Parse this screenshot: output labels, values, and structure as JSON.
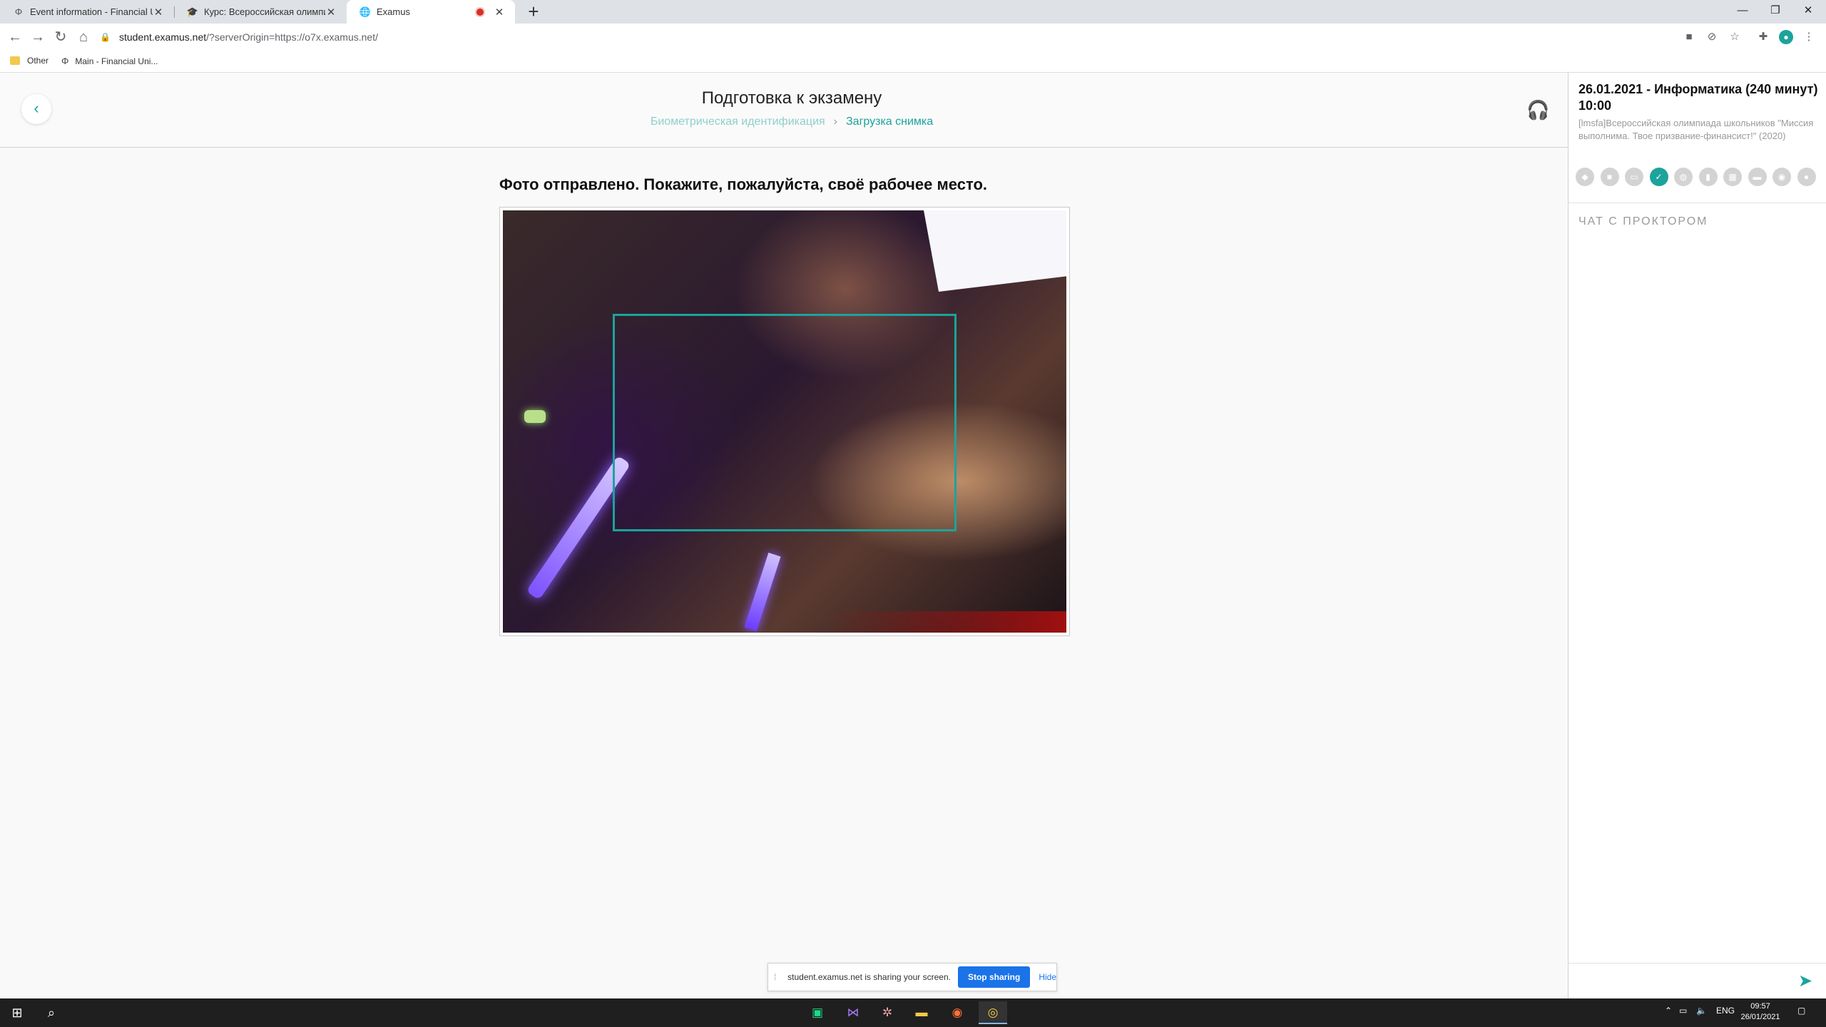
{
  "browser": {
    "tabs": [
      {
        "label": "Event information - Financial Uni",
        "favicon": "Φ"
      },
      {
        "label": "Курс: Всероссийская олимпиада",
        "favicon": "🎓"
      },
      {
        "label": "Examus",
        "favicon": "🌐"
      }
    ],
    "url_domain": "student.examus.net",
    "url_path": "/?serverOrigin=https://o7x.examus.net/",
    "bookmarks": [
      "Other",
      "Main - Financial Uni..."
    ]
  },
  "header": {
    "title": "Подготовка к экзамену",
    "breadcrumb_step1": "Биометрическая идентификация",
    "breadcrumb_step2": "Загрузка снимка"
  },
  "main": {
    "instruction": "Фото отправлено. Покажите, пожалуйста, своё рабочее место."
  },
  "sidebar": {
    "exam_title": "26.01.2021 - Информатика (240 минут) 10:00",
    "exam_description": "[lmsfa]Всероссийская олимпиада школьников \"Миссия выполнима. Твое призвание-финансист!\" (2020)",
    "chat_title": "ЧАТ С ПРОКТОРОМ",
    "status_icons": [
      "megaphone-icon",
      "book-icon",
      "id-card-icon",
      "checklist-icon",
      "globe-icon",
      "book-open-icon",
      "grid-icon",
      "camera-icon",
      "eye-icon",
      "user-icon"
    ]
  },
  "share_bar": {
    "message": "student.examus.net is sharing your screen.",
    "stop_label": "Stop sharing",
    "hide_label": "Hide"
  },
  "taskbar": {
    "language": "ENG",
    "time": "09:57",
    "date": "26/01/2021"
  },
  "colors": {
    "accent": "#1ba39c",
    "share_button": "#1a73e8"
  }
}
